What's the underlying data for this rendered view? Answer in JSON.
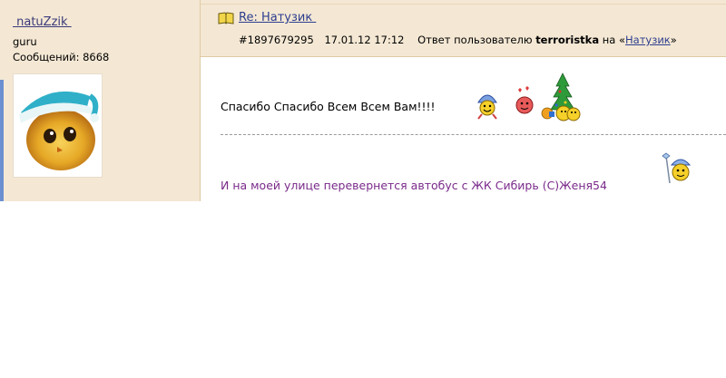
{
  "user": {
    "name": " natuZzik ",
    "rank": "guru",
    "messages_label": "Сообщений: 8668"
  },
  "post": {
    "title": "Re: Натузик ",
    "number": "#1897679295",
    "date": "17.01.12 17:12",
    "reply_prefix": "Ответ пользователю",
    "reply_to": "terroristka",
    "on_label": "на «",
    "topic_link": "Натузик",
    "topic_close": "»",
    "body": "Спасибо Спасибо Всем Всем Вам!!!!",
    "signature": "И на моей улице перевернется автобус с ЖК Сибирь (С)Женя54"
  },
  "icons": [
    "book-icon",
    "snow-maiden-smiley-icon",
    "love-smiley-icon",
    "christmas-tree-smiley-icon",
    "wizard-smiley-icon"
  ],
  "colors": {
    "sidebar_bg": "#f4e8d4",
    "link": "#2d3d8e",
    "signature": "#7a2a8a",
    "accent": "#6b8fd0"
  }
}
